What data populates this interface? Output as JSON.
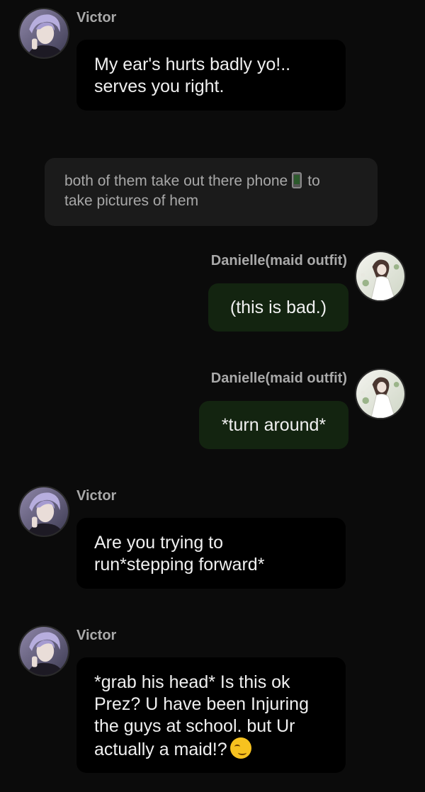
{
  "messages": [
    {
      "sender": "Victor",
      "side": "left",
      "lines": [
        "My ear's hurts badly yo!..",
        "serves you right."
      ]
    },
    {
      "type": "narration",
      "line1_before": "both of them take out there phone",
      "line1_after": "to",
      "line2": "take pictures of hem",
      "icon": "phone-icon"
    },
    {
      "sender": "Danielle(maid outfit)",
      "side": "right",
      "text": "(this is bad.)"
    },
    {
      "sender": "Danielle(maid outfit)",
      "side": "right",
      "text": "*turn around*"
    },
    {
      "sender": "Victor",
      "side": "left",
      "lines": [
        "Are you trying to",
        "run*stepping forward*"
      ]
    },
    {
      "sender": "Victor",
      "side": "left",
      "lines": [
        "*grab his head* Is this ok",
        "Prez? U have been Injuring",
        "the guys at school. but Ur",
        "actually a maid!?"
      ],
      "emoji": "smirking-face-icon"
    }
  ],
  "colors": {
    "background": "#0b0b0b",
    "left_bubble": "#000000",
    "right_bubble": "#132410",
    "narration_bubble": "#1b1b1b",
    "name_text": "#a9a9a9"
  }
}
